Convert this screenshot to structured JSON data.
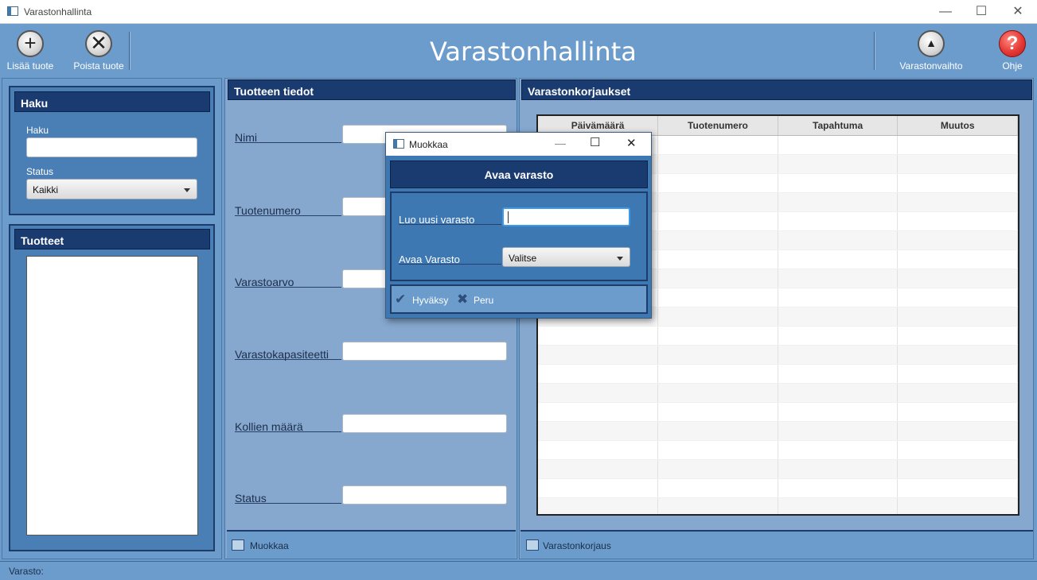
{
  "window": {
    "title": "Varastonhallinta"
  },
  "toolbar": {
    "add_label": "Lisää tuote",
    "remove_label": "Poista tuote",
    "app_title": "Varastonhallinta",
    "switch_label": "Varastonvaihto",
    "help_label": "Ohje",
    "help_glyph": "?"
  },
  "search": {
    "header": "Haku",
    "haku_label": "Haku",
    "haku_value": "",
    "status_label": "Status",
    "status_value": "Kaikki"
  },
  "products": {
    "header": "Tuotteet",
    "items": []
  },
  "details": {
    "header": "Tuotteen tiedot",
    "fields": [
      {
        "label": "Nimi",
        "value": ""
      },
      {
        "label": "Tuotenumero",
        "value": ""
      },
      {
        "label": "Varastoarvo",
        "value": ""
      },
      {
        "label": "Varastokapasiteetti",
        "value": ""
      },
      {
        "label": "Kollien määrä",
        "value": ""
      },
      {
        "label": "Status",
        "value": ""
      }
    ],
    "edit_label": "Muokkaa"
  },
  "corrections": {
    "header": "Varastonkorjaukset",
    "columns": [
      "Päivämäärä",
      "Tuotenumero",
      "Tapahtuma",
      "Muutos"
    ],
    "rows": [],
    "button_label": "Varastonkorjaus"
  },
  "dialog": {
    "title": "Muokkaa",
    "header": "Avaa varasto",
    "new_label": "Luo uusi varasto",
    "new_value": "",
    "open_label": "Avaa Varasto",
    "open_value": "Valitse",
    "accept_label": "Hyväksy",
    "cancel_label": "Peru"
  },
  "statusbar": {
    "label": "Varasto:"
  },
  "colors": {
    "background": "#6b9ccb",
    "panel": "#4a7fb6",
    "header": "#1a3b70"
  }
}
